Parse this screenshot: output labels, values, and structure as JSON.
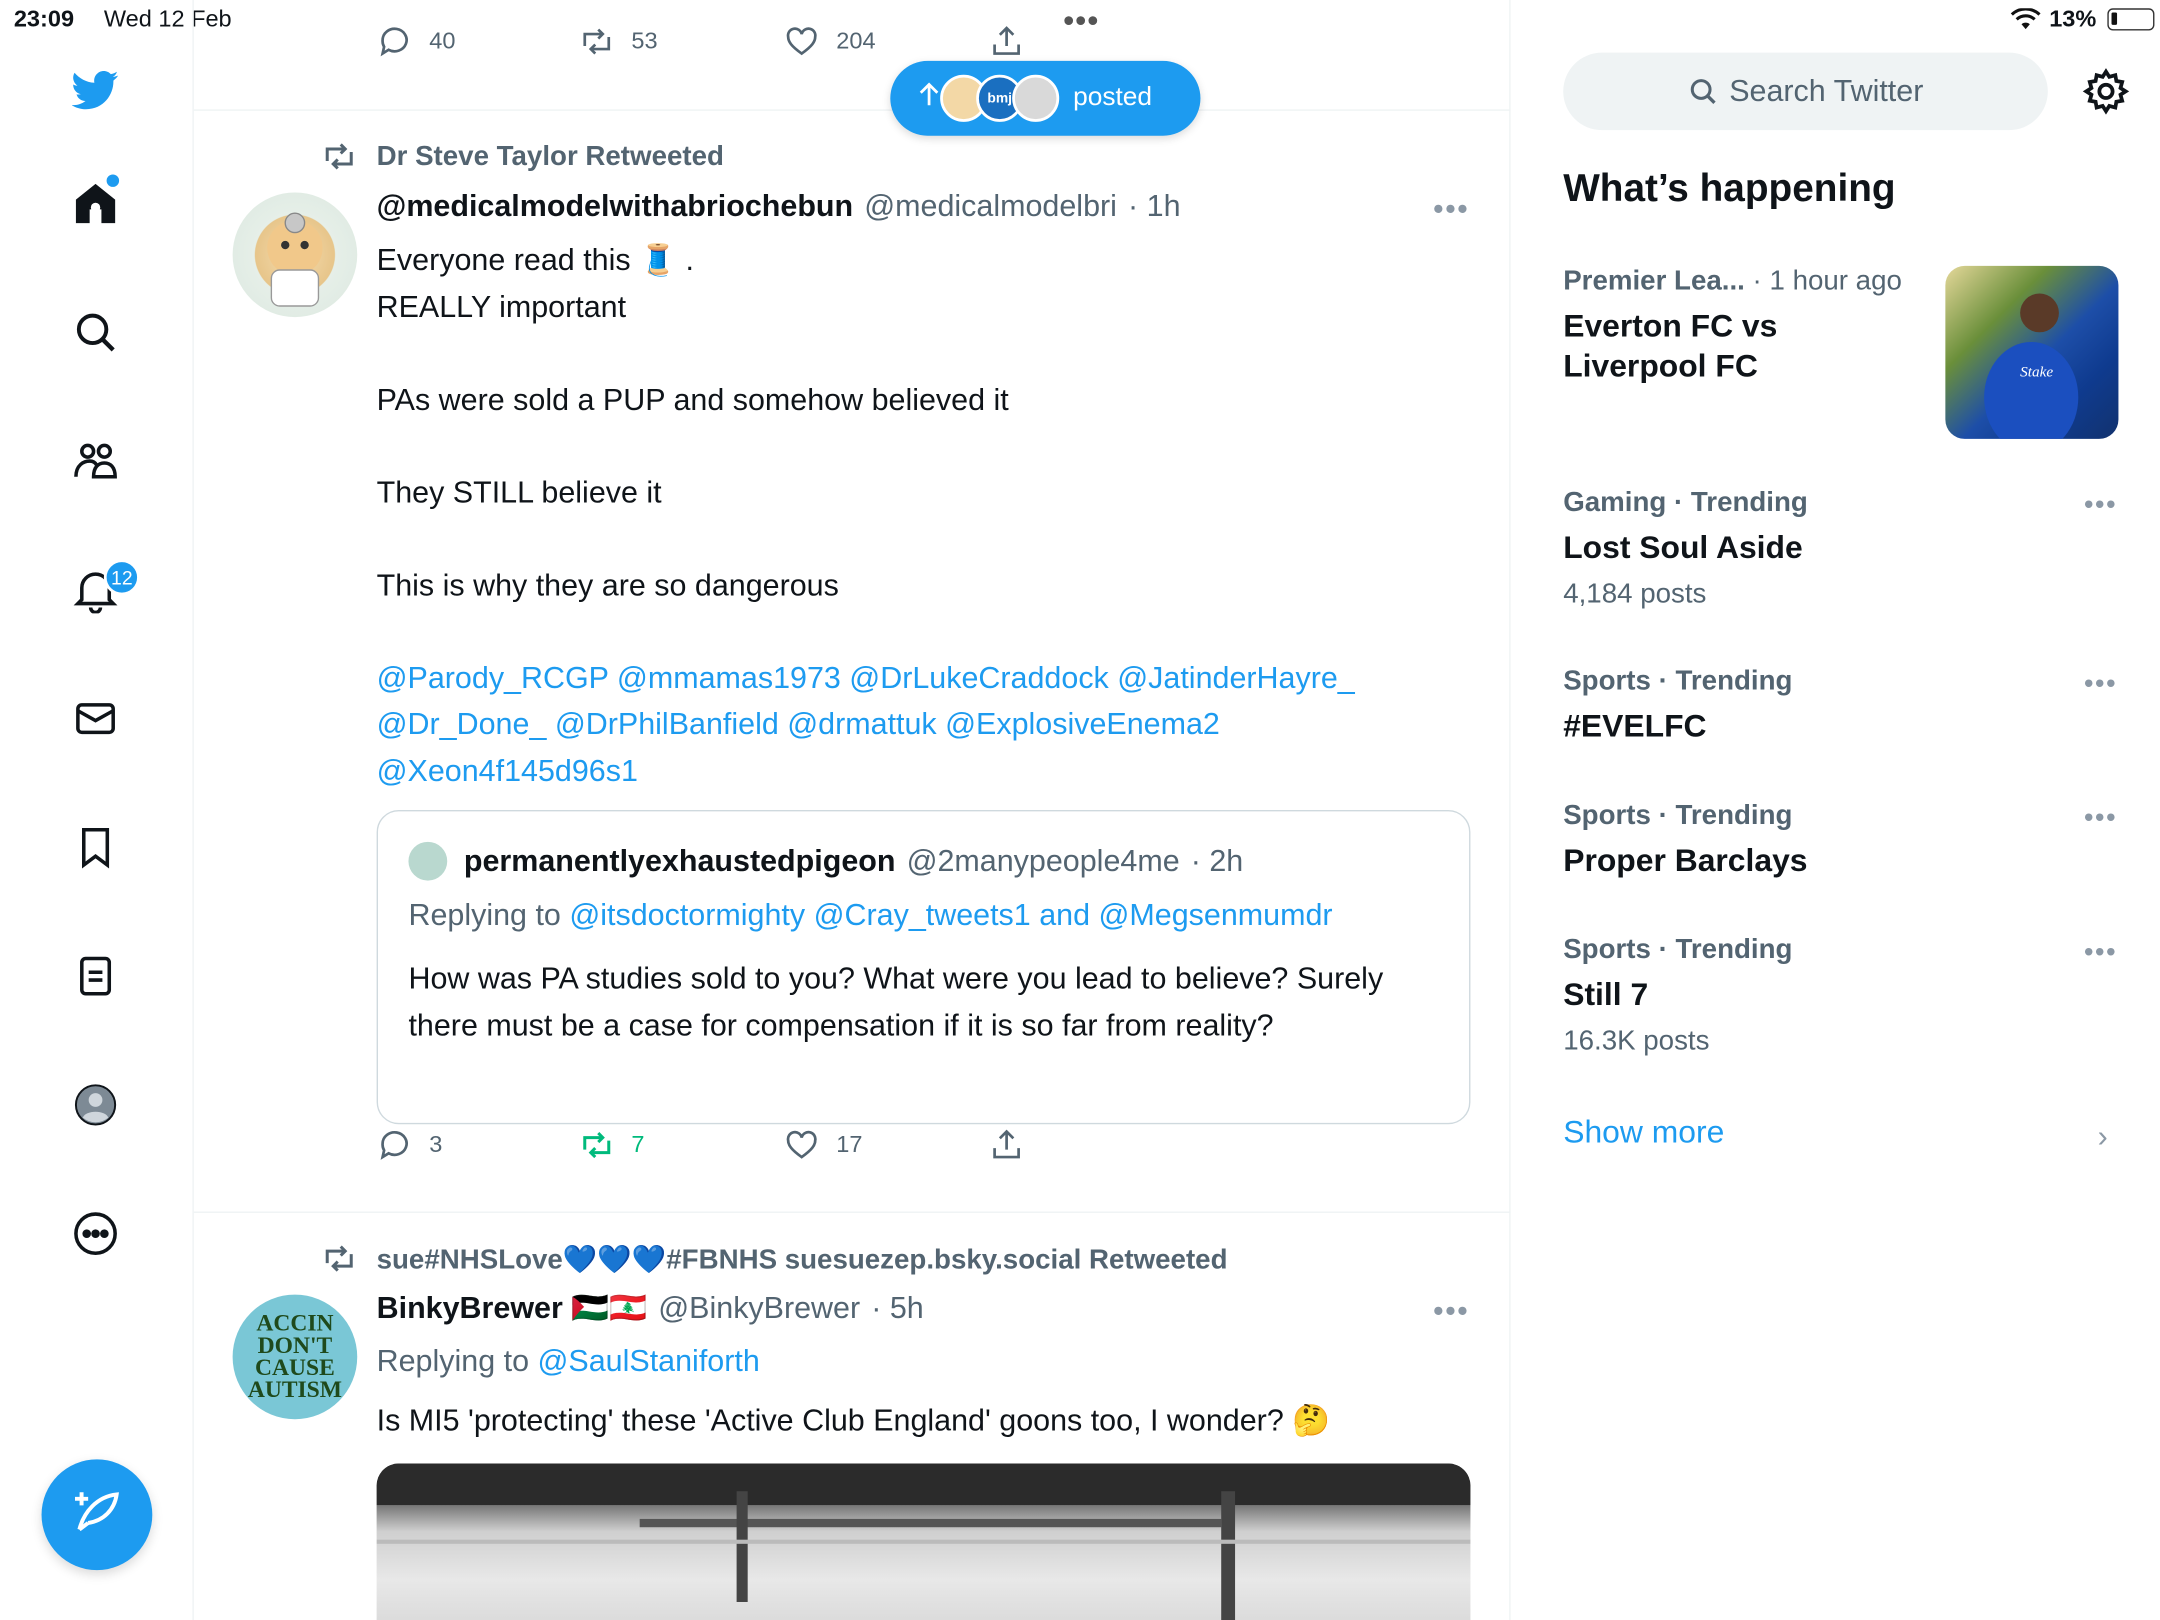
{
  "status_bar": {
    "time": "23:09",
    "date": "Wed 12 Feb",
    "battery": "13%"
  },
  "colors": {
    "accent": "#1d9bf0",
    "retweet_active": "#00ba7c",
    "muted": "#536471"
  },
  "nav": {
    "icons": [
      "twitter-logo-icon",
      "home-icon",
      "search-icon",
      "communities-icon",
      "notifications-icon",
      "messages-icon",
      "bookmarks-icon",
      "lists-icon",
      "profile-icon",
      "more-icon"
    ],
    "notifications_badge": "12",
    "compose": "compose-tweet-icon"
  },
  "prev_tweet": {
    "replies": "40",
    "retweets": "53",
    "likes": "204"
  },
  "posted_pill": {
    "label": "posted",
    "avatar_label": "bmj"
  },
  "tweet1": {
    "retweeted_by": "Dr Steve Taylor Retweeted",
    "name": "@medicalmodelwithabriochebun",
    "handle": "@medicalmodelbri",
    "time": "· 1h",
    "lines": [
      "Everyone read this 🧵 .",
      "REALLY important",
      "",
      "PAs were sold a PUP and somehow believed it",
      "",
      "They STILL believe it",
      "",
      "This is why they are so dangerous",
      ""
    ],
    "mentions": [
      "@Parody_RCGP @mmamas1973 @DrLukeCraddock @JatinderHayre_",
      "@Dr_Done_ @DrPhilBanfield @drmattuk @ExplosiveEnema2",
      "@Xeon4f145d96s1"
    ],
    "quote": {
      "name": "permanentlyexhaustedpigeon",
      "handle": "@2manypeople4me",
      "time": "· 2h",
      "replying_prefix": "Replying to",
      "replying_to": "@itsdoctormighty @Cray_tweets1 and @Megsenmumdr",
      "text": "How was PA studies sold to you? What were you lead to believe? Surely there must be a case for compensation if it is so far from reality?"
    },
    "replies": "3",
    "retweets": "7",
    "likes": "17"
  },
  "tweet2": {
    "retweeted_by": "sue#NHSLove💙💙💙#FBNHS suesuezep.bsky.social Retweeted",
    "name": "BinkyBrewer 🇵🇸🇱🇧",
    "handle": "@BinkyBrewer",
    "time": "· 5h",
    "replying_prefix": "Replying to",
    "replying_to": "@SaulStaniforth",
    "text": "Is MI5 'protecting' these 'Active Club England' goons too, I wonder? 🤔",
    "avatar_text": "ACCIN DON'T CAUSE AUTISM"
  },
  "right": {
    "search_placeholder": "Search Twitter",
    "section_title": "What’s happening",
    "trends": [
      {
        "category": "Premier Lea...",
        "extra": "· 1 hour ago",
        "title": "Everton FC vs Liverpool FC",
        "count": ""
      },
      {
        "category": "Gaming · Trending",
        "extra": "",
        "title": "Lost Soul Aside",
        "count": "4,184 posts"
      },
      {
        "category": "Sports · Trending",
        "extra": "",
        "title": "#EVELFC",
        "count": ""
      },
      {
        "category": "Sports · Trending",
        "extra": "",
        "title": "Proper Barclays",
        "count": ""
      },
      {
        "category": "Sports · Trending",
        "extra": "",
        "title": "Still 7",
        "count": "16.3K posts"
      }
    ],
    "show_more": "Show more"
  }
}
